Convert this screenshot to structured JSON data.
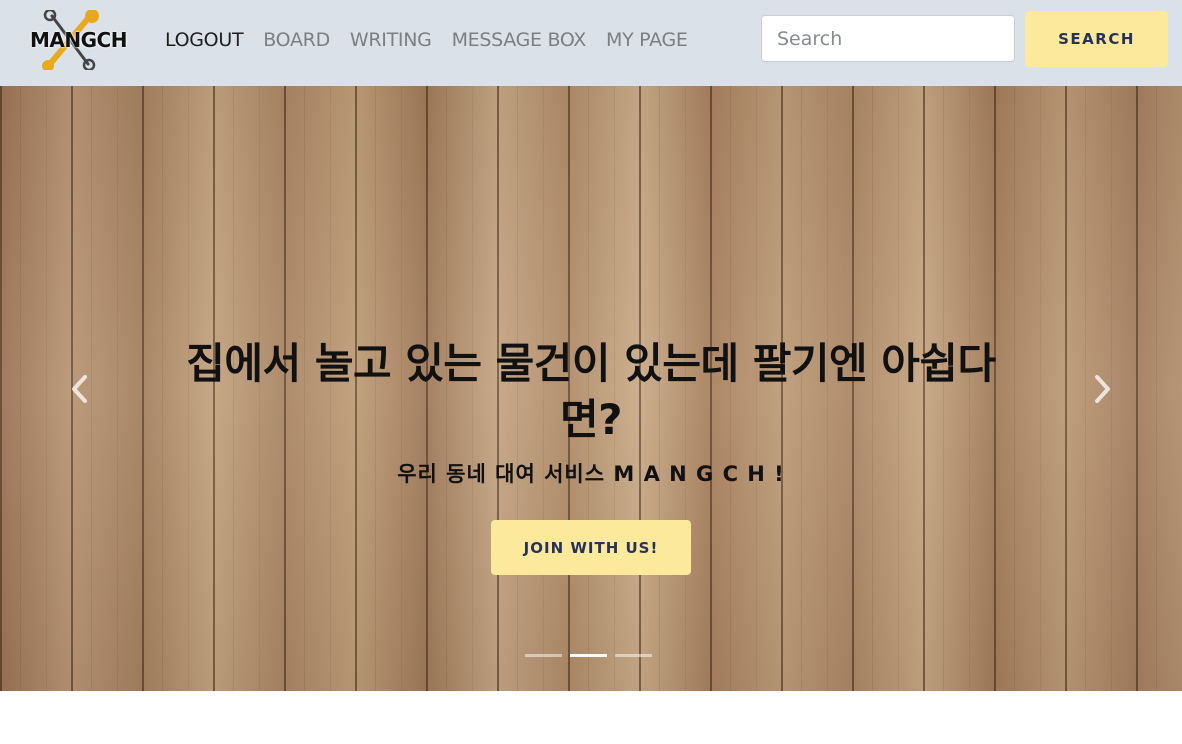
{
  "navbar": {
    "logo_text": "MANGCH",
    "links": [
      {
        "label": "LOGOUT",
        "active": true
      },
      {
        "label": "BOARD",
        "active": false
      },
      {
        "label": "WRITING",
        "active": false
      },
      {
        "label": "MESSAGE BOX",
        "active": false
      },
      {
        "label": "MY PAGE",
        "active": false
      }
    ],
    "search": {
      "placeholder": "Search",
      "value": ""
    },
    "search_button_label": "SEARCH"
  },
  "carousel": {
    "headline": "집에서 놀고 있는 물건이 있는데 팔기엔 아쉽다면?",
    "subheadline": "우리 동네 대여 서비스 M A N G C H !",
    "join_button_label": "JOIN WITH US!",
    "slides_count": 3,
    "active_slide": 2,
    "prev_icon": "chevron-left-icon",
    "next_icon": "chevron-right-icon"
  },
  "colors": {
    "navbar_bg": "#dae1e8",
    "accent_button": "#fde99b",
    "accent_button_text": "#27325a"
  }
}
